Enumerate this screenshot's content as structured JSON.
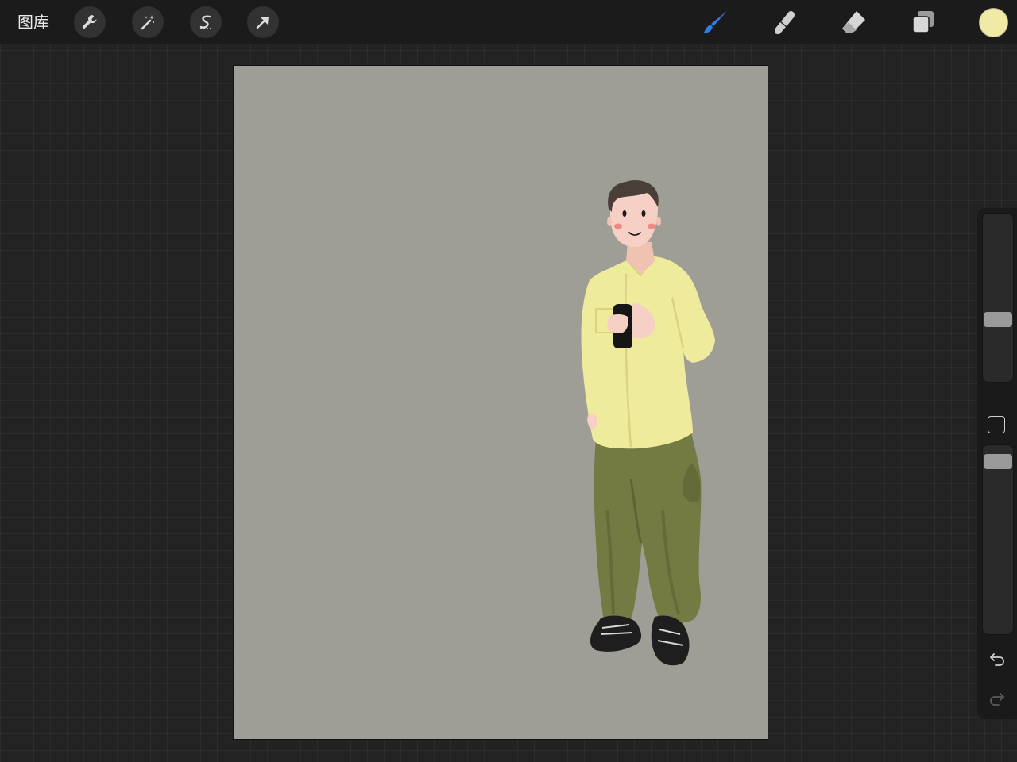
{
  "topbar": {
    "gallery_label": "图库",
    "left_tools": [
      {
        "name": "actions",
        "icon": "wrench-icon"
      },
      {
        "name": "adjustments",
        "icon": "magic-wand-icon"
      },
      {
        "name": "selection",
        "icon": "selection-s-icon"
      },
      {
        "name": "transform",
        "icon": "arrow-cursor-icon"
      }
    ],
    "right_tools": [
      {
        "name": "brush",
        "icon": "brush-icon",
        "active": true
      },
      {
        "name": "smudge",
        "icon": "smudge-finger-icon",
        "active": false
      },
      {
        "name": "eraser",
        "icon": "eraser-icon",
        "active": false
      },
      {
        "name": "layers",
        "icon": "layers-icon",
        "active": false
      }
    ],
    "current_color": "#f0eaa6"
  },
  "colors": {
    "app_background": "#232323",
    "topbar": "#1b1b1b",
    "canvas_background": "#9e9e96",
    "active_tool": "#2f7de8"
  },
  "sidebar": {
    "brush_size": 0.35,
    "opacity": 0.95,
    "buttons": [
      "modify-button",
      "undo-icon",
      "redo-icon"
    ]
  },
  "artwork": {
    "subject_colors": {
      "shirt": "#eeeb9c",
      "pants": "#737a42",
      "hair": "#4a3f38",
      "skin": "#f6d0c4",
      "shoes": "#1e1e1e"
    }
  }
}
